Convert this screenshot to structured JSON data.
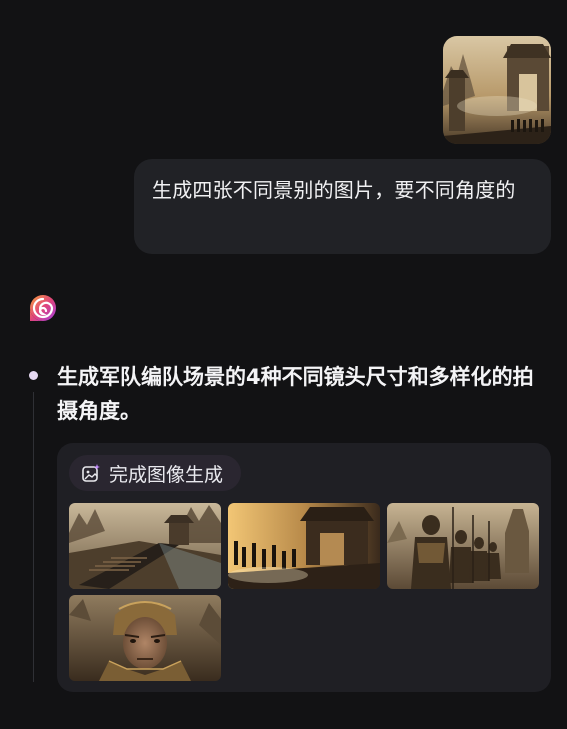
{
  "user_message": {
    "image_alt_icon": "reference-image",
    "text": "生成四张不同景别的图片，要不同角度的"
  },
  "assistant": {
    "avatar_icon": "assistant-logo-icon",
    "bullet_text": "生成军队编队场景的4种不同镜头尺寸和多样化的拍摄角度。",
    "result": {
      "status_icon": "image-sparkle-icon",
      "status_label": "完成图像生成",
      "images": [
        "wide-army-formation",
        "gate-soldiers-wide",
        "armored-soldiers-medium",
        "warrior-closeup"
      ]
    }
  },
  "colors": {
    "background": "#121214",
    "bubble": "#212226",
    "card": "#1f1f24",
    "chip": "#2a2630",
    "accent_gradient_start": "#f6a13a",
    "accent_gradient_end": "#a23de0"
  }
}
